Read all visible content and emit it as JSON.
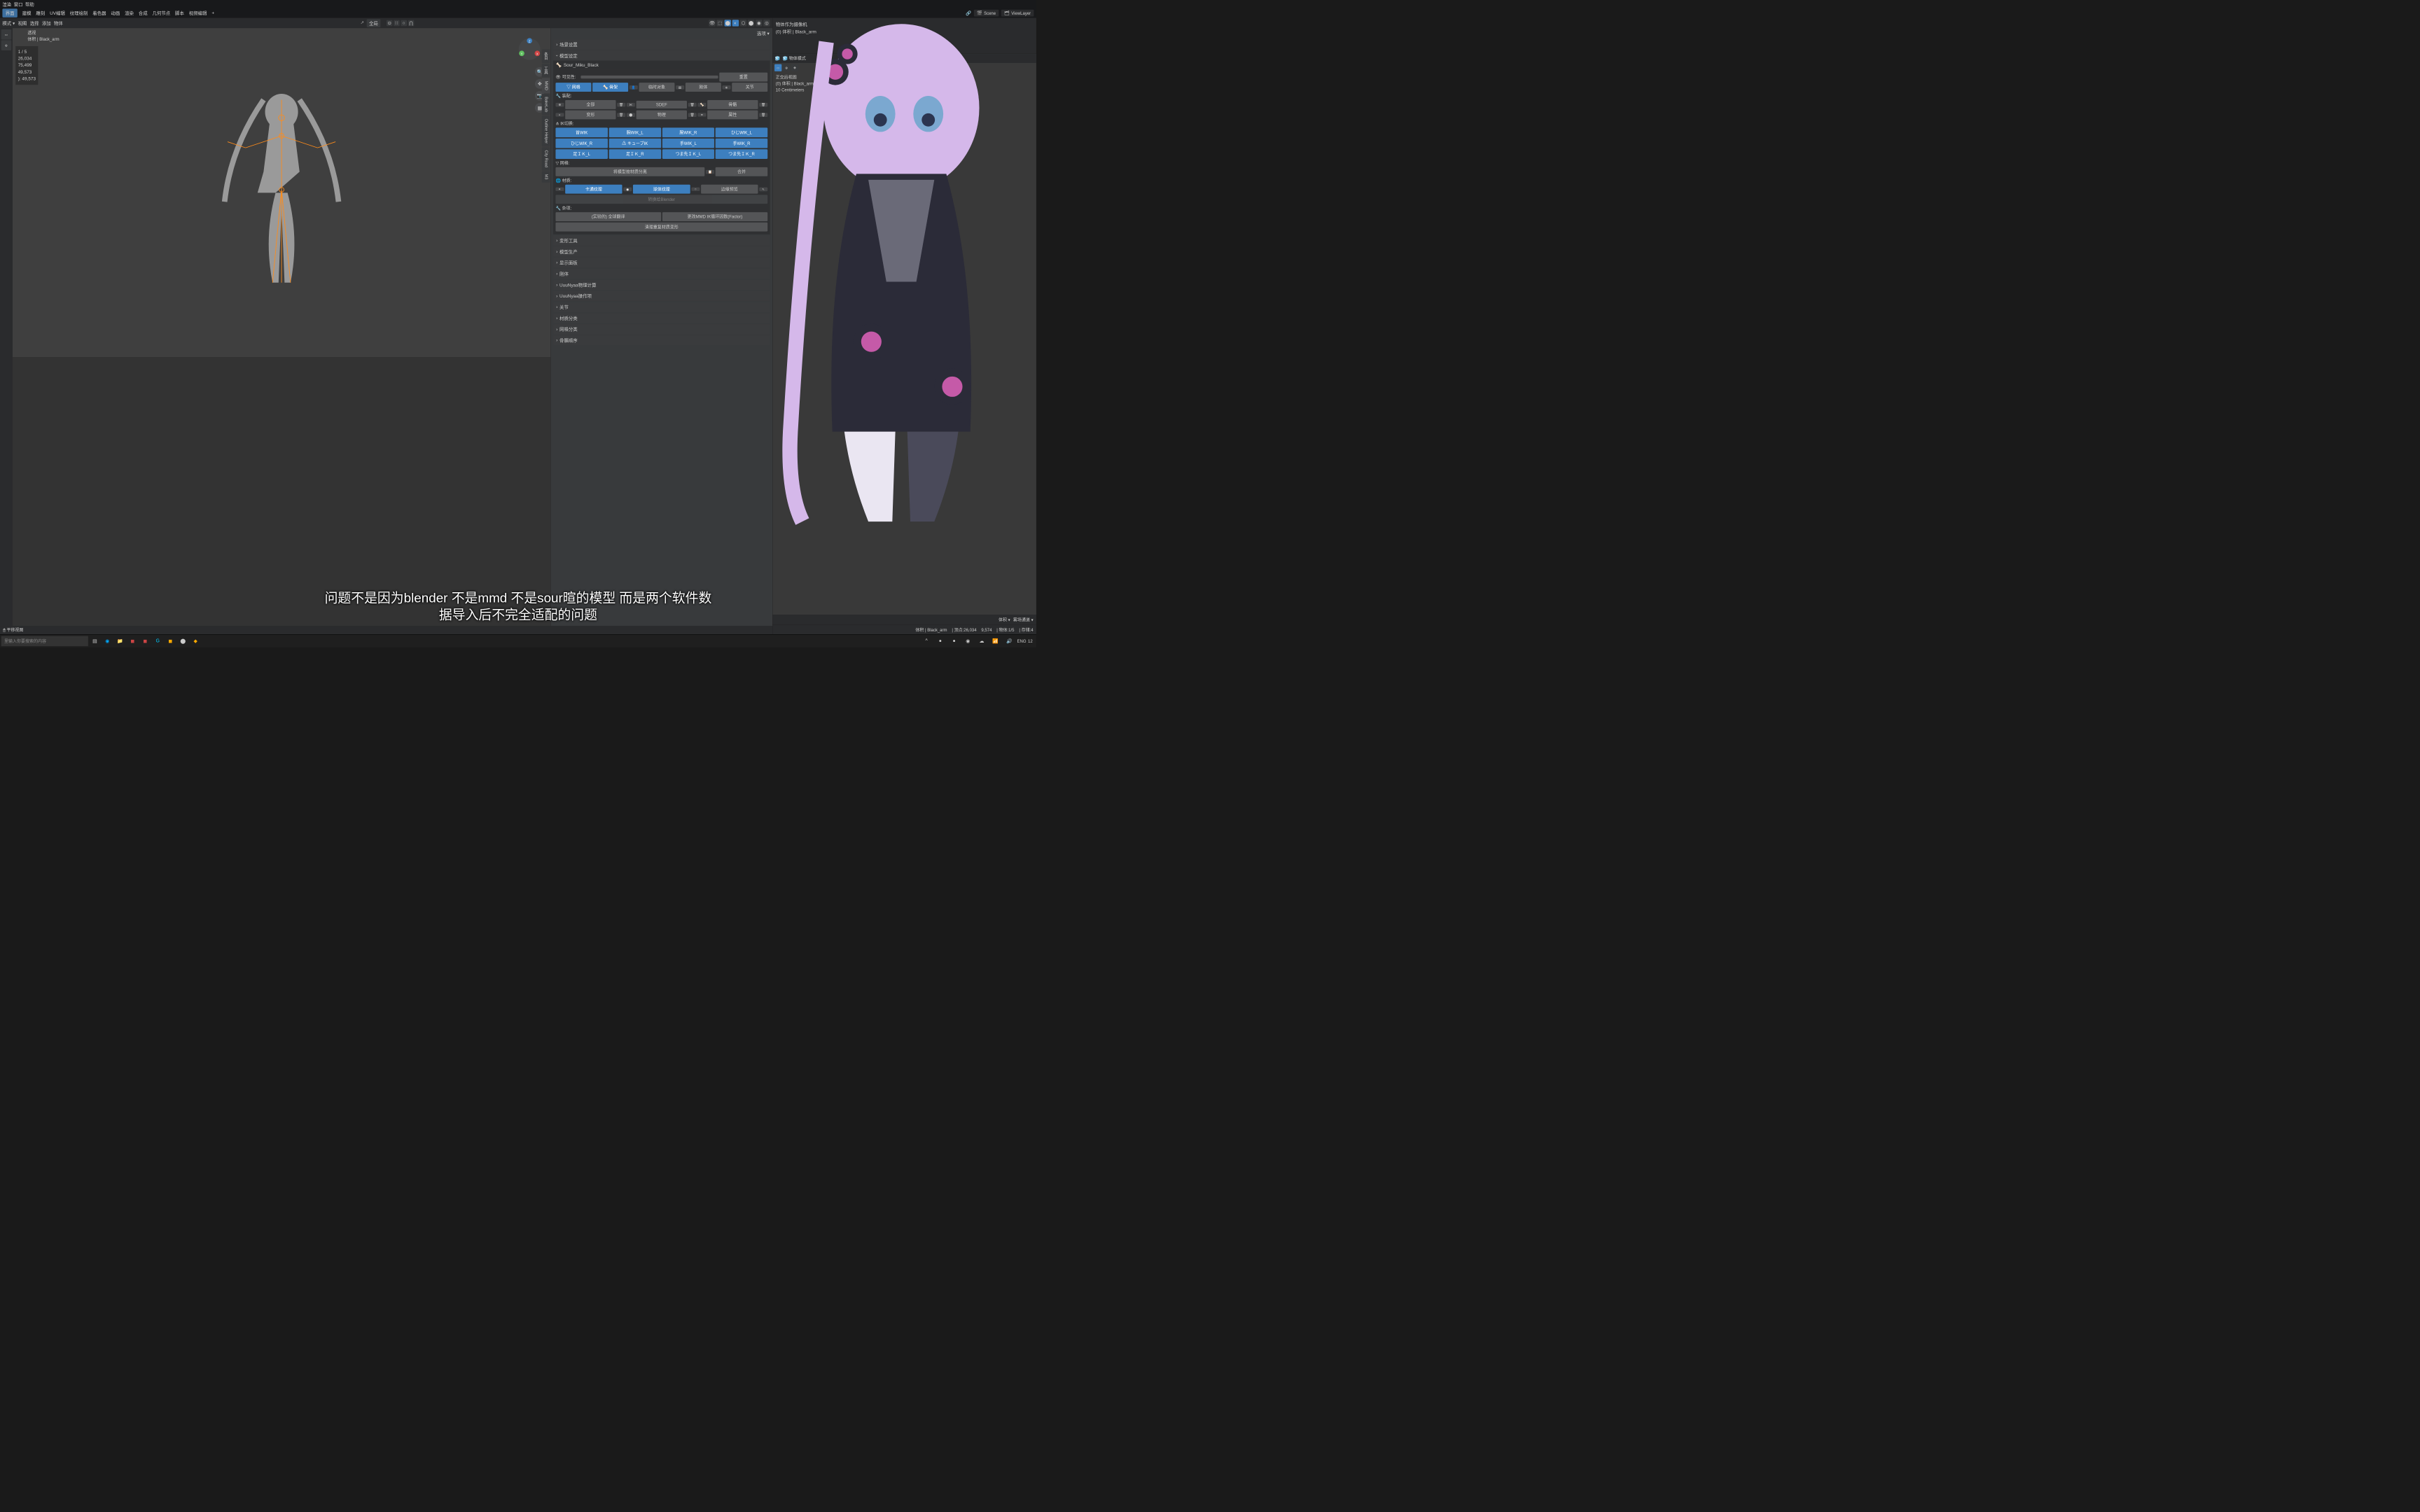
{
  "topbar": {
    "items": [
      "渲染",
      "窗口",
      "帮助"
    ]
  },
  "menubar": {
    "workspaces": [
      "界面",
      "建模",
      "雕刻",
      "UV编辑",
      "纹理绘制",
      "着色器",
      "动画",
      "渲染",
      "合成",
      "几何节点",
      "脚本",
      "视频编辑",
      "+"
    ],
    "active": "界面",
    "scene_label": "Scene",
    "viewlayer_label": "ViewLayer"
  },
  "viewport_header": {
    "mode": "模式 ▾",
    "view": "视图",
    "select": "选择",
    "add": "添加",
    "object": "物体",
    "coord": "全局",
    "coord_icon": "🡕"
  },
  "overlay": {
    "persp": "透视",
    "objname": "体积 | Black_arm",
    "values": [
      "1 / 5",
      "26,034",
      "75,499",
      "49,573",
      "49,573"
    ],
    "indent_prefix": "):"
  },
  "sidepanel": {
    "options_label": "选项 ▾",
    "sections": {
      "scene": "场景设置",
      "modelset": "模型设定"
    },
    "model_name": "Sour_Miku_Black",
    "visibility_label": "可见性:",
    "reset_btn": "重置",
    "mesh_btn": "网格",
    "rig_btn": "骨架",
    "temp_btn": "临时对象",
    "rigid_btn": "刚体",
    "joint_btn": "关节",
    "assemble_label": "装配:",
    "all_btn": "全部",
    "sdef_btn": "SDEF",
    "bone_btn": "骨骼",
    "morph_btn": "变形",
    "phys_btn": "物理",
    "attr_btn": "属性",
    "ik_label": "IK切换:",
    "ik": [
      "首WIK",
      "腕WIK_L",
      "腕WIK_R",
      "ひじWIK_L",
      "ひじWIK_R",
      "キューブIK",
      "手WIK_L",
      "手WIK_R",
      "足ＩＫ_L",
      "足ＩＫ_R",
      "つま先ＩＫ_L",
      "つま先ＩＫ_R"
    ],
    "mesh_label": "网格:",
    "split_btn": "将模型按材质分离",
    "merge_btn": "合并",
    "mat_label": "材质:",
    "toon_btn": "卡通纹理",
    "sphere_btn": "球体纹理",
    "edge_btn": "边缘预览",
    "convert_btn": "转换给Blender",
    "misc_label": "杂项:",
    "global_flip": "(实验的) 全球翻译",
    "change_ik": "更改MMD IK循环因数(Factor)",
    "cleanup": "清理重复材质变形",
    "collapsed": [
      "变形工具",
      "模型生产",
      "显示面板",
      "刚体",
      "UuuNyaa物理计算",
      "UuuNyaa操作项",
      "关节",
      "材质分类",
      "网格分类",
      "骨骼顺序"
    ]
  },
  "side_tabs": [
    "条目",
    "工具",
    "MMD",
    "BakeLab",
    "Outline Helper",
    "City Road",
    "M3"
  ],
  "outliner": {
    "title": "物体作为摄像机",
    "item": "(0) 体积 | Black_arm"
  },
  "secondary_vp": {
    "mode": "物体模式",
    "view_title": "正交后视图",
    "obj": "(0) 体积 | Black_arm",
    "scale": "10 Centimeters"
  },
  "bottom_props": {
    "volume": "体积 ▾",
    "fog": "雾场通道 ▾"
  },
  "status": {
    "obj": "体积 | Black_arm",
    "verts": "顶点:26,034",
    "v2": "9,574",
    "objs": "物体:1/5",
    "mem": "存储:4"
  },
  "footer_hint": "平移视图",
  "subtitle": {
    "line1": "问题不是因为blender 不是mmd 不是sour暄的模型 而是两个软件数",
    "line2": "据导入后不完全适配的问题"
  },
  "taskbar": {
    "search_placeholder": "里输入你要搜索的内容",
    "lang": "ENG",
    "time": "12"
  },
  "colors": {
    "accent": "#3d7fbf",
    "armature": "#ff8c1a"
  }
}
